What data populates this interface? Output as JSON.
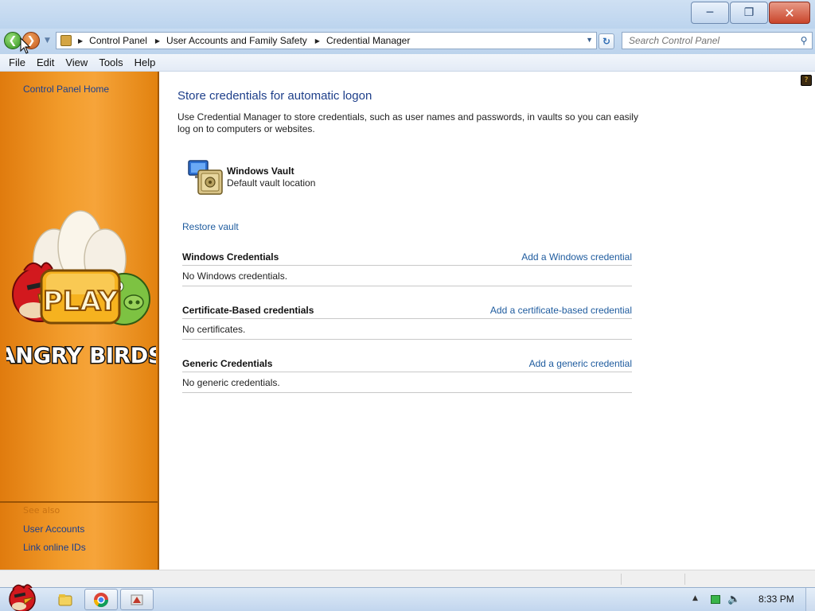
{
  "window": {
    "controls": {
      "minimize": "minimize",
      "maximize": "restore",
      "close": "close"
    }
  },
  "address": {
    "breadcrumbs": [
      "Control Panel",
      "User Accounts and Family Safety",
      "Credential Manager"
    ],
    "search_placeholder": "Search Control Panel"
  },
  "menu": [
    "File",
    "Edit",
    "View",
    "Tools",
    "Help"
  ],
  "sidebar": {
    "home_link": "Control Panel Home",
    "see_also_heading": "See also",
    "links": [
      "User Accounts",
      "Link online IDs"
    ],
    "artwork": {
      "play_label": "PLAY",
      "brand": "ANGRY BIRDS"
    }
  },
  "main": {
    "title": "Store credentials for automatic logon",
    "description": "Use Credential Manager to store credentials, such as user names and passwords, in vaults so you can easily log on to computers or websites.",
    "vault": {
      "name": "Windows Vault",
      "location": "Default vault location"
    },
    "restore_link": "Restore vault",
    "sections": [
      {
        "title": "Windows Credentials",
        "add_link": "Add a Windows credential",
        "empty_text": "No Windows credentials."
      },
      {
        "title": "Certificate-Based credentials",
        "add_link": "Add a certificate-based credential",
        "empty_text": "No certificates."
      },
      {
        "title": "Generic Credentials",
        "add_link": "Add a generic credential",
        "empty_text": "No generic credentials."
      }
    ]
  },
  "taskbar": {
    "clock": "8:33 PM",
    "pinned": [
      "explorer-icon",
      "chrome-icon",
      "app-icon"
    ]
  },
  "colors": {
    "sidebar": "#f29c2b",
    "link": "#1e5b9e",
    "title": "#1e3f8a"
  }
}
